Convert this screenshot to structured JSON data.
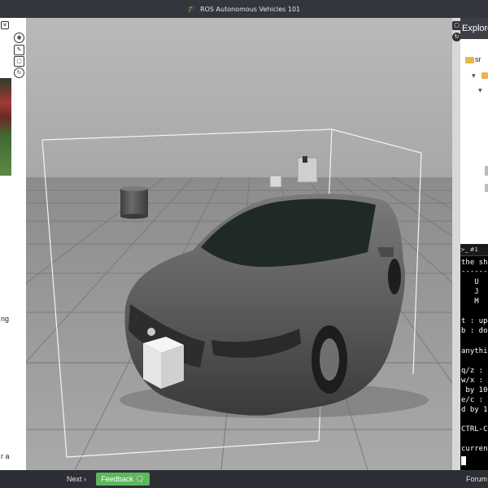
{
  "window": {
    "title": "ROS Autonomous Vehicles 101",
    "title_icon": "graduation-cap-icon"
  },
  "left_panel": {
    "text_fragments": [
      "ng",
      "r a"
    ]
  },
  "left_toolbar": {
    "buttons": [
      "eye-icon",
      "wrench-icon",
      "fullscreen-icon",
      "stop-icon",
      "refresh-icon"
    ]
  },
  "explorer": {
    "title": "Explorer",
    "root_label": "sr"
  },
  "terminal": {
    "tab_label": ">_ #1",
    "lines": [
      "the sh",
      "------",
      "   U",
      "   J",
      "   M",
      "",
      "t : up",
      "b : do",
      "",
      "anythi",
      "",
      "q/z :",
      "w/x :",
      " by 10",
      "e/c :",
      "d by 1",
      "",
      "CTRL-C",
      "",
      "curren"
    ]
  },
  "bottom_bar": {
    "next_label": "Next ›",
    "feedback_label": "Feedback",
    "forum_label": "Forum"
  },
  "colors": {
    "topbar": "#33363d",
    "feedback_green": "#5cb85c",
    "folder": "#e8b64c",
    "terminal_bg": "#000000"
  }
}
